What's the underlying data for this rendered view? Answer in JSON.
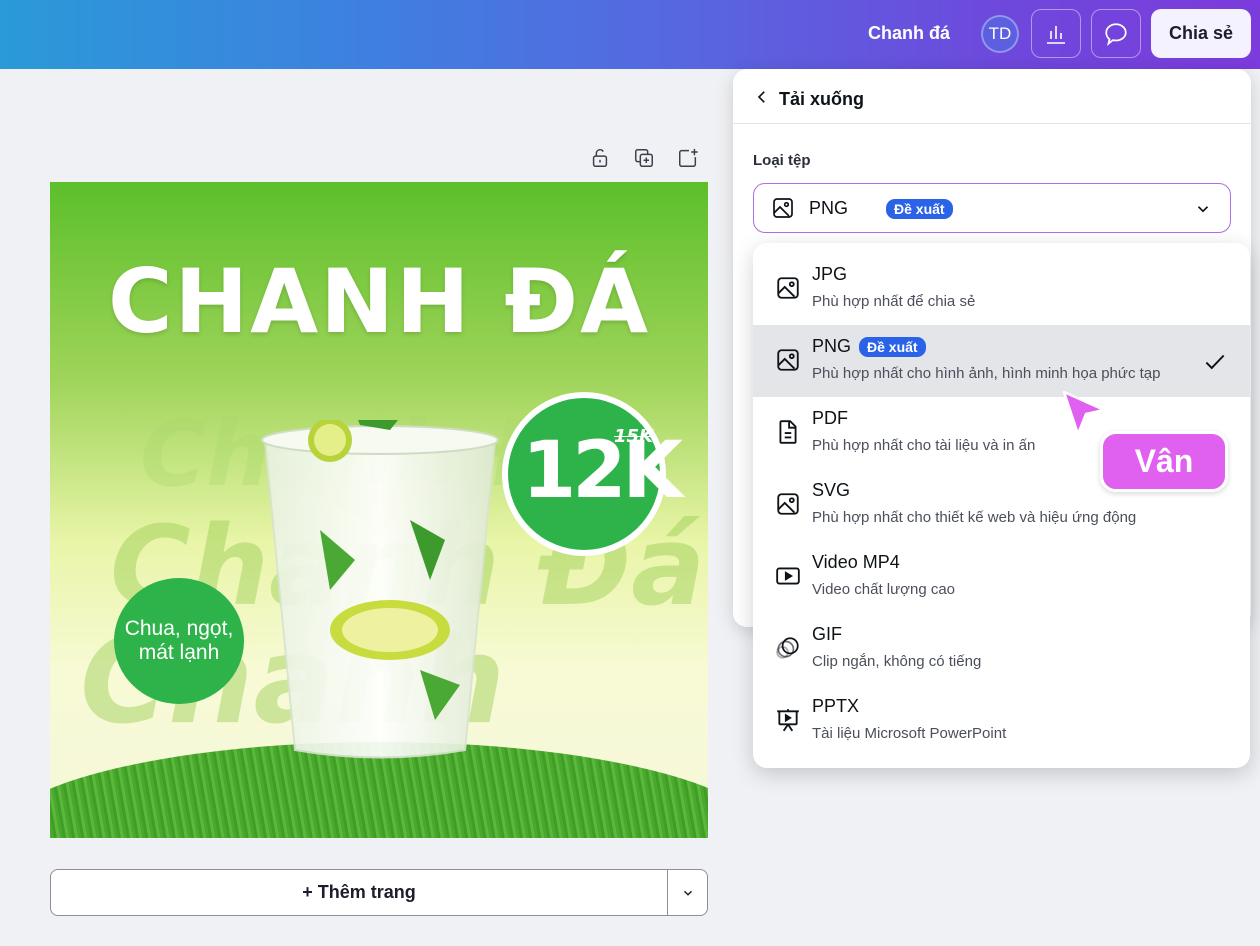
{
  "header": {
    "doc_title": "Chanh đá",
    "avatar_initials": "TD",
    "share_label": "Chia sẻ"
  },
  "design": {
    "headline": "CHANH ĐÁ",
    "price": "12K",
    "old_price": "15K",
    "tagline": "Chua, ngọt, mát lạnh",
    "background_text": "Chanh Đá"
  },
  "canvas_footer": {
    "add_page_label": "+ Thêm trang"
  },
  "download_panel": {
    "title": "Tải xuống",
    "file_type_label": "Loại tệp",
    "selected_value": "PNG",
    "recommended_badge": "Đề xuất",
    "options": [
      {
        "name": "JPG",
        "desc": "Phù hợp nhất để chia sẻ",
        "icon": "image-icon"
      },
      {
        "name": "PNG",
        "desc": "Phù hợp nhất cho hình ảnh, hình minh họa phức tạp",
        "icon": "image-icon",
        "badge": "Đề xuất",
        "selected": true
      },
      {
        "name": "PDF",
        "desc": "Phù hợp nhất cho tài liệu và in ấn",
        "icon": "document-icon"
      },
      {
        "name": "SVG",
        "desc": "Phù hợp nhất cho thiết kế web và hiệu ứng động",
        "icon": "image-icon"
      },
      {
        "name": "Video MP4",
        "desc": "Video chất lượng cao",
        "icon": "video-icon"
      },
      {
        "name": "GIF",
        "desc": "Clip ngắn, không có tiếng",
        "icon": "gif-icon"
      },
      {
        "name": "PPTX",
        "desc": "Tài liệu Microsoft PowerPoint",
        "icon": "presentation-icon"
      }
    ]
  },
  "collaborator": {
    "name": "Vân",
    "color": "#e060f0"
  },
  "colors": {
    "accent": "#2a62e8",
    "brand_green": "#2eb34a"
  }
}
